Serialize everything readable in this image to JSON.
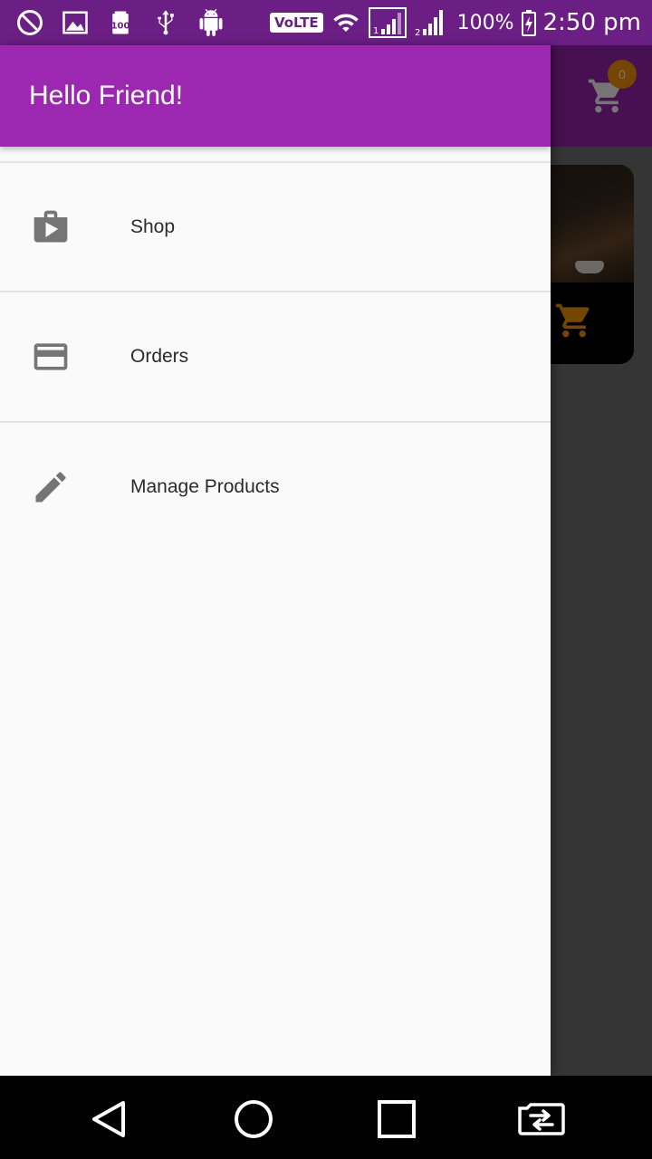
{
  "status_bar": {
    "left_icons": [
      "do-not-disturb-icon",
      "image-icon",
      "battery-100-icon",
      "usb-icon",
      "android-icon"
    ],
    "volte_label": "VoLTE",
    "sim1_label": "1",
    "sim2_label": "2",
    "battery_percent": "100%",
    "time": "2:50 pm"
  },
  "drawer": {
    "title": "Hello Friend!",
    "items": [
      {
        "label": "Shop",
        "icon": "shop-icon"
      },
      {
        "label": "Orders",
        "icon": "credit-card-icon"
      },
      {
        "label": "Manage Products",
        "icon": "edit-icon"
      }
    ]
  },
  "background_app": {
    "cart_count": "0",
    "colors": {
      "primary": "#9c27b0",
      "accent": "#ff9800"
    }
  },
  "nav_bar": {
    "buttons": [
      "back-icon",
      "home-icon",
      "recents-icon",
      "switch-sim-icon"
    ]
  }
}
